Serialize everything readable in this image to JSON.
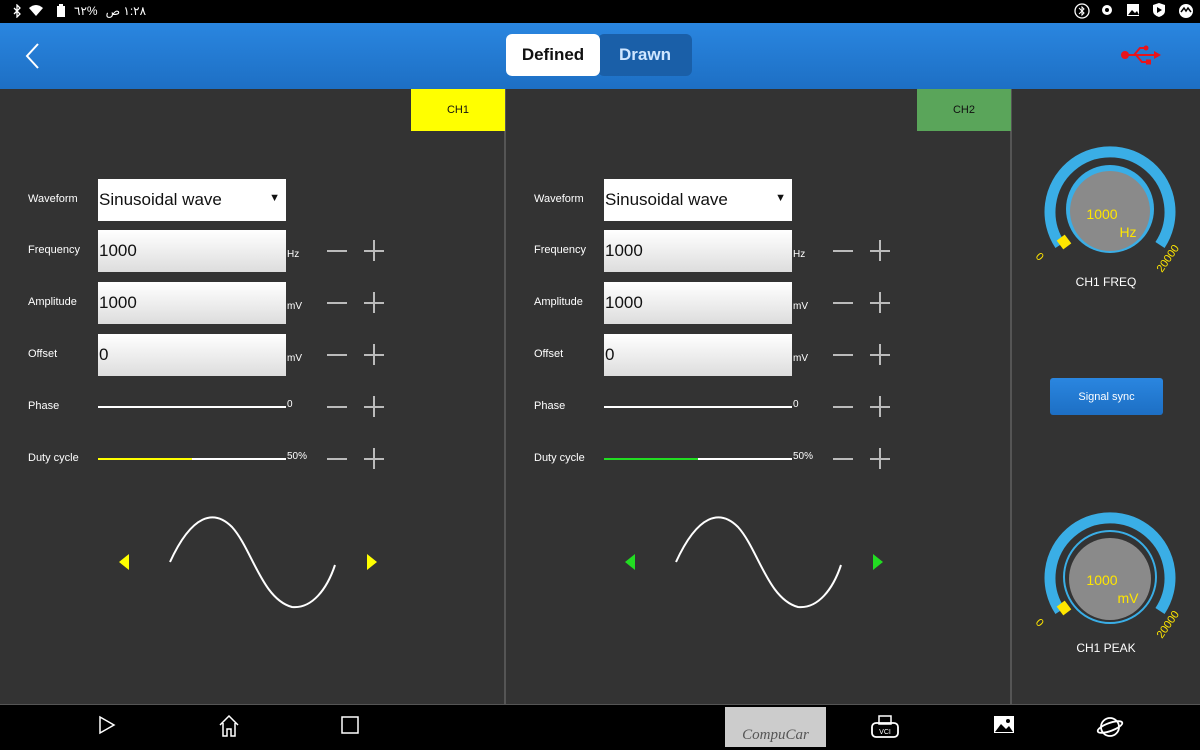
{
  "status_bar": {
    "time": "١:٢٨ ص",
    "battery": "%٦٢",
    "icons": [
      "battery-icon",
      "wifi-icon",
      "bluetooth-icon"
    ],
    "right_icons": [
      "bluetooth-circle-icon",
      "shield-small-icon",
      "image-icon",
      "play-shield-icon",
      "app-icon"
    ]
  },
  "header": {
    "back_icon": "back-chevron-icon",
    "tabs": [
      {
        "label": "Defined",
        "active": true
      },
      {
        "label": "Drawn",
        "active": false
      }
    ],
    "usb_icon": "usb-icon",
    "usb_color": "#e8141c"
  },
  "channels": [
    {
      "name": "CH1",
      "color": "#ffff00",
      "waveform_label": "Waveform",
      "waveform_value": "Sinusoidal wave",
      "frequency_label": "Frequency",
      "frequency_value": "1000",
      "frequency_unit": "Hz",
      "amplitude_label": "Amplitude",
      "amplitude_value": "1000",
      "amplitude_unit": "mV",
      "offset_label": "Offset",
      "offset_value": "0",
      "offset_unit": "mV",
      "phase_label": "Phase",
      "phase_value": "0",
      "phase_fraction": 0,
      "duty_label": "Duty cycle",
      "duty_value": "50%",
      "duty_fraction": 0.5
    },
    {
      "name": "CH2",
      "color": "#5aa55a",
      "accent": "#22dd22",
      "waveform_label": "Waveform",
      "waveform_value": "Sinusoidal wave",
      "frequency_label": "Frequency",
      "frequency_value": "1000",
      "frequency_unit": "Hz",
      "amplitude_label": "Amplitude",
      "amplitude_value": "1000",
      "amplitude_unit": "mV",
      "offset_label": "Offset",
      "offset_value": "0",
      "offset_unit": "mV",
      "phase_label": "Phase",
      "phase_value": "0",
      "phase_fraction": 0,
      "duty_label": "Duty cycle",
      "duty_value": "50%",
      "duty_fraction": 0.5
    }
  ],
  "side": {
    "freq_knob": {
      "value": "1000",
      "unit": "Hz",
      "min": "0",
      "max": "20000",
      "label": "CH1 FREQ"
    },
    "sync_button": "Signal sync",
    "peak_knob": {
      "value": "1000",
      "unit": "mV",
      "min": "0",
      "max": "20000",
      "label": "CH1 PEAK"
    }
  },
  "navbar": {
    "icons": [
      "back-triangle-icon",
      "home-icon",
      "recents-icon",
      "vci-icon",
      "gallery-icon",
      "browser-icon"
    ],
    "logo_text": "CompuCar"
  }
}
